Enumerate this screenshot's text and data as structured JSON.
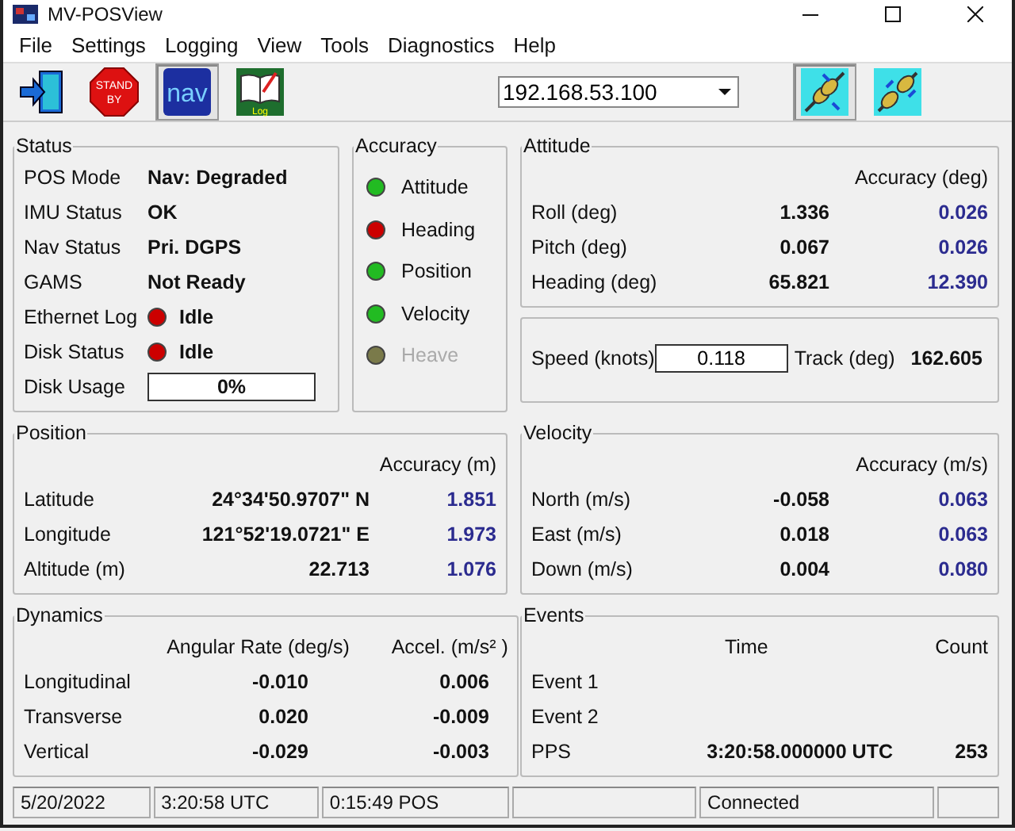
{
  "window": {
    "title": "MV-POSView"
  },
  "menu": [
    "File",
    "Settings",
    "Logging",
    "View",
    "Tools",
    "Diagnostics",
    "Help"
  ],
  "toolbar": {
    "tools": [
      {
        "kind": "exit",
        "selected": false
      },
      {
        "kind": "standby",
        "label": "STAND BY",
        "selected": false
      },
      {
        "kind": "nav",
        "label": "nav",
        "selected": true
      },
      {
        "kind": "log",
        "label": "Log",
        "selected": false
      }
    ],
    "address": {
      "value": "192.168.53.100"
    },
    "connection": [
      {
        "kind": "connect",
        "selected": true
      },
      {
        "kind": "disconnect",
        "selected": false
      }
    ]
  },
  "status": {
    "title": "Status",
    "rows": [
      {
        "kind": "text",
        "label": "POS Mode",
        "value": "Nav: Degraded"
      },
      {
        "kind": "text",
        "label": "IMU Status",
        "value": "OK"
      },
      {
        "kind": "text",
        "label": "Nav Status",
        "value": "Pri. DGPS"
      },
      {
        "kind": "text",
        "label": "GAMS",
        "value": "Not Ready"
      },
      {
        "kind": "led",
        "label": "Ethernet Log",
        "value": "Idle",
        "color": "#cc0000"
      },
      {
        "kind": "led",
        "label": "Disk Status",
        "value": "Idle",
        "color": "#cc0000"
      },
      {
        "kind": "meter",
        "label": "Disk Usage",
        "value": "0%",
        "level": 0
      }
    ]
  },
  "accuracy": {
    "title": "Accuracy",
    "items": [
      {
        "label": "Attitude",
        "color": "#22bb22",
        "disabled": false
      },
      {
        "label": "Heading",
        "color": "#cc0000",
        "disabled": false
      },
      {
        "label": "Position",
        "color": "#22bb22",
        "disabled": false
      },
      {
        "label": "Velocity",
        "color": "#22bb22",
        "disabled": false
      },
      {
        "label": "Heave",
        "color": "#7a7a4a",
        "disabled": true
      }
    ]
  },
  "attitude": {
    "title": "Attitude",
    "accuracy_header": "Accuracy (deg)",
    "rows": [
      {
        "label": "Roll (deg)",
        "value": "1.336",
        "accuracy": "0.026"
      },
      {
        "label": "Pitch (deg)",
        "value": "0.067",
        "accuracy": "0.026"
      },
      {
        "label": "Heading (deg)",
        "value": "65.821",
        "accuracy": "12.390"
      }
    ]
  },
  "speed": {
    "label": "Speed (knots)",
    "value": "0.118",
    "track_label": "Track (deg)",
    "track_value": "162.605"
  },
  "position": {
    "title": "Position",
    "accuracy_header": "Accuracy (m)",
    "rows": [
      {
        "label": "Latitude",
        "value": "24°34'50.9707\" N",
        "accuracy": "1.851"
      },
      {
        "label": "Longitude",
        "value": "121°52'19.0721\" E",
        "accuracy": "1.973"
      },
      {
        "label": "Altitude (m)",
        "value": "22.713",
        "accuracy": "1.076"
      }
    ]
  },
  "velocity": {
    "title": "Velocity",
    "accuracy_header": "Accuracy (m/s)",
    "rows": [
      {
        "label": "North (m/s)",
        "value": "-0.058",
        "accuracy": "0.063"
      },
      {
        "label": "East  (m/s)",
        "value": "0.018",
        "accuracy": "0.063"
      },
      {
        "label": "Down (m/s)",
        "value": "0.004",
        "accuracy": "0.080"
      }
    ]
  },
  "dynamics": {
    "title": "Dynamics",
    "columns": [
      "Angular Rate (deg/s)",
      "Accel. (m/s² )"
    ],
    "rows": [
      {
        "label": "Longitudinal",
        "rate": "-0.010",
        "accel": "0.006"
      },
      {
        "label": "Transverse",
        "rate": "0.020",
        "accel": "-0.009"
      },
      {
        "label": "Vertical",
        "rate": "-0.029",
        "accel": "-0.003"
      }
    ]
  },
  "events": {
    "title": "Events",
    "columns": [
      "Time",
      "Count"
    ],
    "rows": [
      {
        "label": "Event 1"
      },
      {
        "label": "Event 2"
      },
      {
        "label": "PPS",
        "time": "3:20:58.000000 UTC",
        "count": "253"
      }
    ]
  },
  "status_bar": [
    "5/20/2022",
    "3:20:58 UTC",
    "0:15:49 POS",
    "Connected"
  ]
}
